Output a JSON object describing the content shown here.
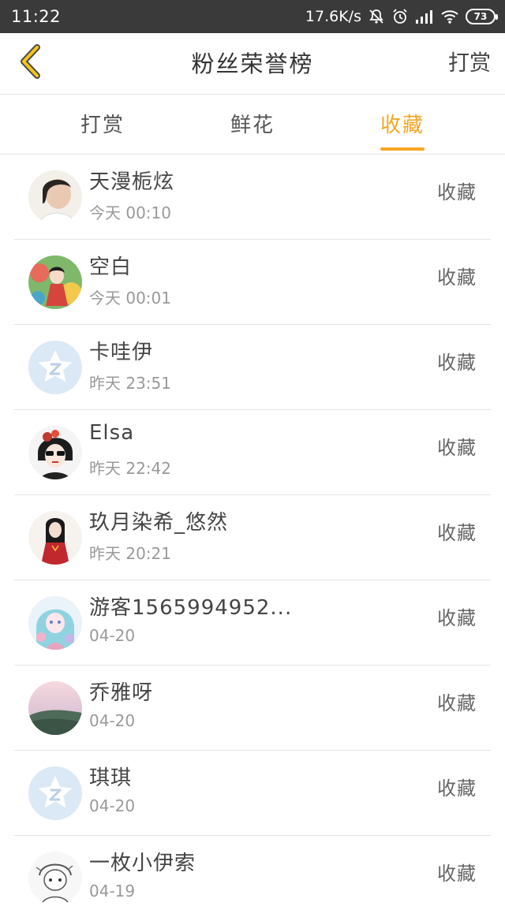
{
  "status_bar": {
    "time": "11:22",
    "network_speed": "17.6K/s",
    "battery": "73"
  },
  "header": {
    "title": "粉丝荣誉榜",
    "action_label": "打赏",
    "accent_color": "#f5a623"
  },
  "tabs": [
    {
      "label": "打赏",
      "active": false
    },
    {
      "label": "鲜花",
      "active": false
    },
    {
      "label": "收藏",
      "active": true
    }
  ],
  "fans": [
    {
      "name": "天漫栀炫",
      "time": "今天 00:10",
      "action": "收藏",
      "avatar": "avatar-photo-girl-white"
    },
    {
      "name": "空白",
      "time": "今天 00:01",
      "action": "收藏",
      "avatar": "avatar-anime-green"
    },
    {
      "name": "卡哇伊",
      "time": "昨天 23:51",
      "action": "收藏",
      "avatar": "avatar-default-star"
    },
    {
      "name": "Elsa",
      "time": "昨天 22:42",
      "action": "收藏",
      "avatar": "avatar-illustration-sunglasses"
    },
    {
      "name": "玖月染希_悠然",
      "time": "昨天 20:21",
      "action": "收藏",
      "avatar": "avatar-illustration-red-dress"
    },
    {
      "name": "游客1565994952...",
      "time": "04-20",
      "action": "收藏",
      "avatar": "avatar-anime-pastel"
    },
    {
      "name": "乔雅呀",
      "time": "04-20",
      "action": "收藏",
      "avatar": "avatar-landscape-pink-sky"
    },
    {
      "name": "琪琪",
      "time": "04-20",
      "action": "收藏",
      "avatar": "avatar-default-star"
    },
    {
      "name": "一枚小伊索",
      "time": "04-19",
      "action": "收藏",
      "avatar": "avatar-sketch"
    }
  ]
}
